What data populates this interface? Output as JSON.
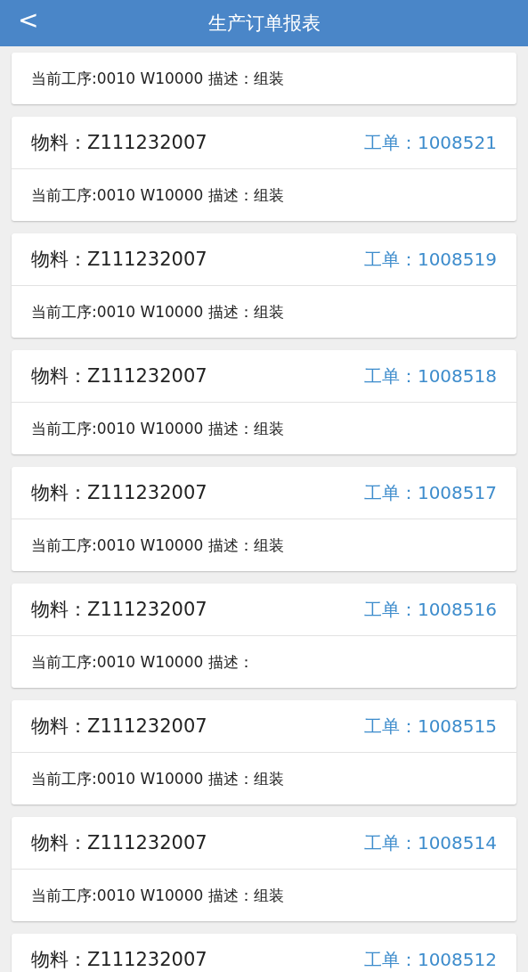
{
  "header": {
    "back": "<",
    "title": "生产订单报表"
  },
  "cards": [
    {
      "description": "当前工序:0010 W10000 描述：组装"
    },
    {
      "material": "物料：Z111232007",
      "order": "工单：1008521",
      "description": "当前工序:0010 W10000 描述：组装"
    },
    {
      "material": "物料：Z111232007",
      "order": "工单：1008519",
      "description": "当前工序:0010 W10000 描述：组装"
    },
    {
      "material": "物料：Z111232007",
      "order": "工单：1008518",
      "description": "当前工序:0010 W10000 描述：组装"
    },
    {
      "material": "物料：Z111232007",
      "order": "工单：1008517",
      "description": "当前工序:0010 W10000 描述：组装"
    },
    {
      "material": "物料：Z111232007",
      "order": "工单：1008516",
      "description": "当前工序:0010 W10000 描述："
    },
    {
      "material": "物料：Z111232007",
      "order": "工单：1008515",
      "description": "当前工序:0010 W10000 描述：组装"
    },
    {
      "material": "物料：Z111232007",
      "order": "工单：1008514",
      "description": "当前工序:0010 W10000 描述：组装"
    },
    {
      "material": "物料：Z111232007",
      "order": "工单：1008512"
    }
  ]
}
